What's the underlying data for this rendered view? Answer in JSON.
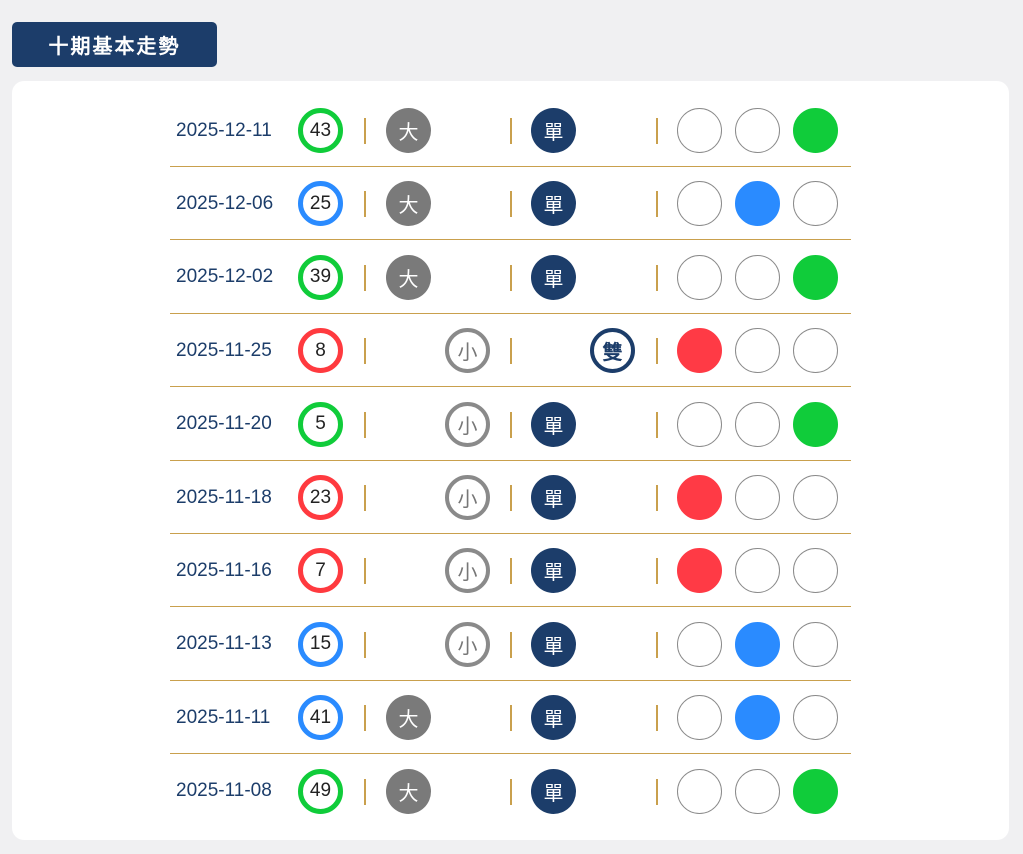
{
  "title": "十期基本走勢",
  "labels": {
    "big": "大",
    "small": "小",
    "odd": "單",
    "even": "雙"
  },
  "colors": {
    "red": "#ff3a45",
    "blue": "#2a8bff",
    "green": "#10cc3a",
    "navy": "#1c3d6a",
    "gold": "#c9a04d"
  },
  "rows": [
    {
      "date": "2025-12-11",
      "number": "43",
      "color": "green",
      "size": "big",
      "parity": "odd"
    },
    {
      "date": "2025-12-06",
      "number": "25",
      "color": "blue",
      "size": "big",
      "parity": "odd"
    },
    {
      "date": "2025-12-02",
      "number": "39",
      "color": "green",
      "size": "big",
      "parity": "odd"
    },
    {
      "date": "2025-11-25",
      "number": "8",
      "color": "red",
      "size": "small",
      "parity": "even"
    },
    {
      "date": "2025-11-20",
      "number": "5",
      "color": "green",
      "size": "small",
      "parity": "odd"
    },
    {
      "date": "2025-11-18",
      "number": "23",
      "color": "red",
      "size": "small",
      "parity": "odd"
    },
    {
      "date": "2025-11-16",
      "number": "7",
      "color": "red",
      "size": "small",
      "parity": "odd"
    },
    {
      "date": "2025-11-13",
      "number": "15",
      "color": "blue",
      "size": "small",
      "parity": "odd"
    },
    {
      "date": "2025-11-11",
      "number": "41",
      "color": "blue",
      "size": "big",
      "parity": "odd"
    },
    {
      "date": "2025-11-08",
      "number": "49",
      "color": "green",
      "size": "big",
      "parity": "odd"
    }
  ]
}
